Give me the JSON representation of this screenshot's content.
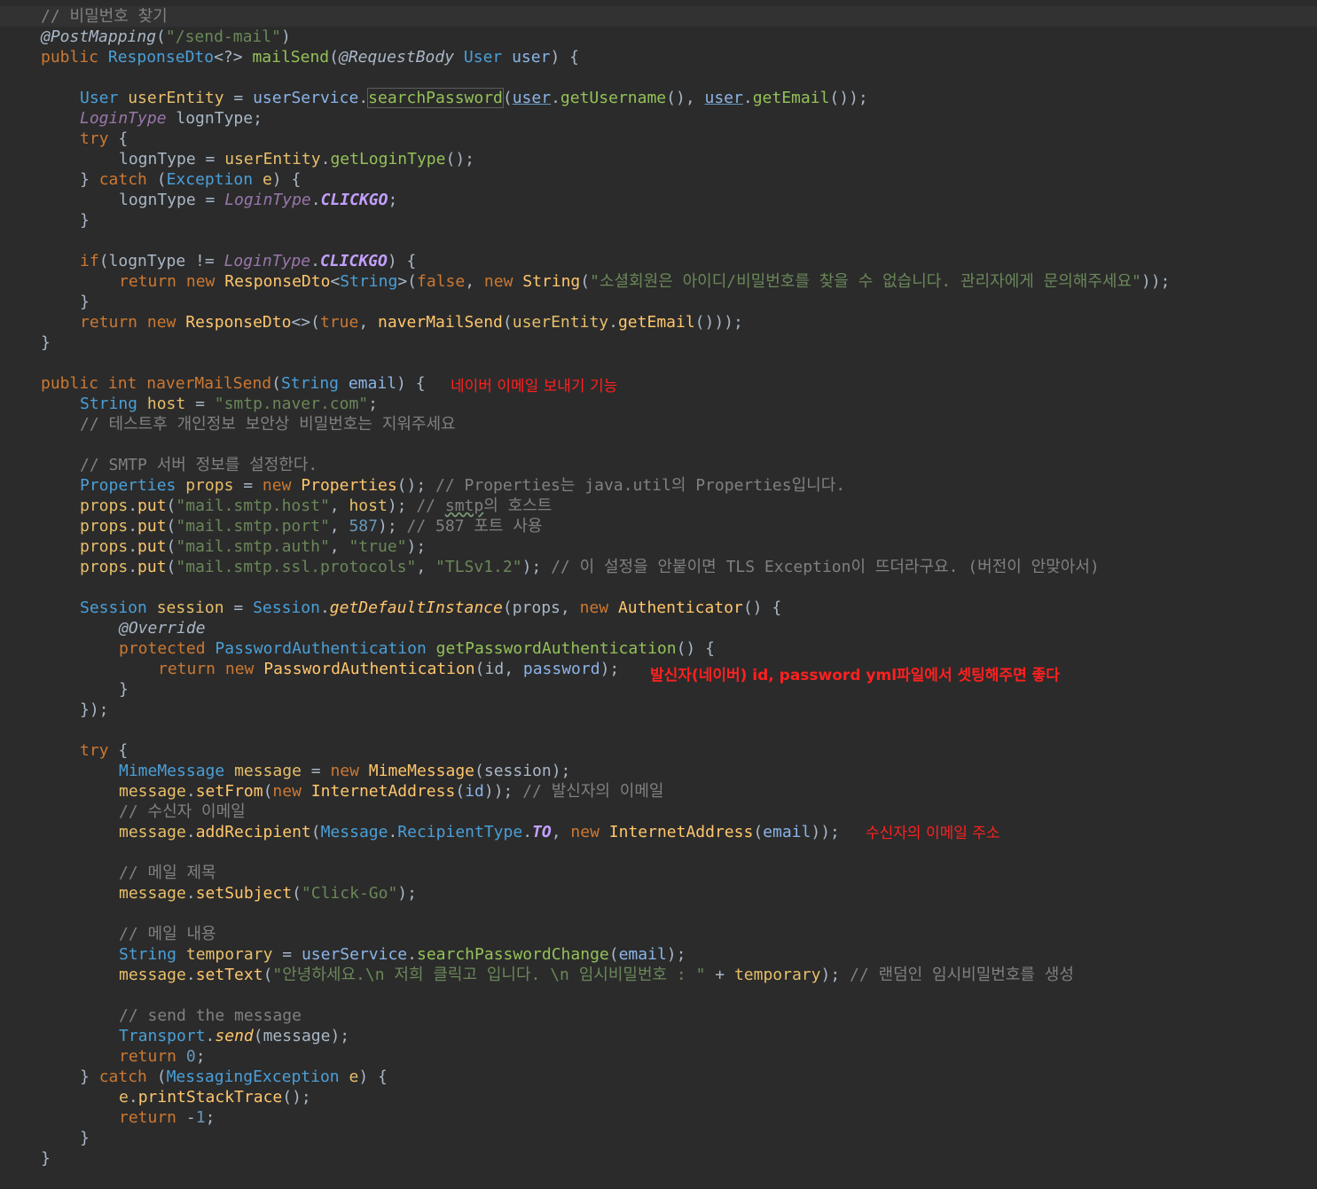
{
  "theme": {
    "background": "#2b2b2b",
    "keyword": "#cc7832",
    "string": "#6a8759",
    "comment": "#808080",
    "annotation_note": "#ff2020"
  },
  "code": {
    "l1": "// 비밀번호 찾기",
    "l2": [
      "@PostMapping",
      "(",
      "\"/send-mail\"",
      ")"
    ],
    "l3": [
      "public",
      " ",
      "ResponseDto",
      "<?> ",
      "mailSend",
      "(",
      "@RequestBody",
      " ",
      "User",
      " ",
      "user",
      ") {"
    ],
    "l5": [
      "User",
      " ",
      "userEntity",
      " = ",
      "userService",
      ".",
      "searchPassword",
      "(",
      "user",
      ".",
      "getUsername",
      "(), ",
      "user",
      ".",
      "getEmail",
      "());"
    ],
    "l6": [
      "LoginType",
      " lognType;"
    ],
    "l7": [
      "try",
      " {"
    ],
    "l8": [
      "lognType = ",
      "userEntity",
      ".",
      "getLoginType",
      "();"
    ],
    "l9": [
      "} ",
      "catch",
      " (",
      "Exception",
      " ",
      "e",
      ") {"
    ],
    "l10": [
      "lognType = ",
      "LoginType",
      ".",
      "CLICKGO",
      ";"
    ],
    "l11": "}",
    "l13": [
      "if",
      "(lognType != ",
      "LoginType",
      ".",
      "CLICKGO",
      ") {"
    ],
    "l14": [
      "return",
      " ",
      "new",
      " ",
      "ResponseDto",
      "<",
      "String",
      ">(",
      "false",
      ", ",
      "new",
      " ",
      "String",
      "(",
      "\"소셜회원은 아이디/비밀번호를 찾을 수 없습니다. 관리자에게 문의해주세요\"",
      "));"
    ],
    "l15": "}",
    "l16": [
      "return",
      " ",
      "new",
      " ",
      "ResponseDto",
      "<>(",
      "true",
      ", ",
      "naverMailSend",
      "(",
      "userEntity",
      ".",
      "getEmail",
      "()));"
    ],
    "l17": "}",
    "l19": [
      "public",
      " ",
      "int",
      " ",
      "naverMailSend",
      "(",
      "String",
      " ",
      "email",
      ") {"
    ],
    "l20": [
      "String",
      " ",
      "host",
      " = ",
      "\"smtp.naver.com\"",
      ";"
    ],
    "l21": "// 테스트후 개인정보 보안상 비밀번호는 지워주세요",
    "l23": "// SMTP 서버 정보를 설정한다.",
    "l24": [
      "Properties",
      " ",
      "props",
      " = ",
      "new",
      " ",
      "Properties",
      "(); ",
      "// Properties는 java.util의 Properties입니다."
    ],
    "l25": [
      "props",
      ".",
      "put",
      "(",
      "\"mail.smtp.host\"",
      ", ",
      "host",
      "); ",
      "// ",
      "smtp",
      "의 호스트"
    ],
    "l26": [
      "props",
      ".",
      "put",
      "(",
      "\"mail.smtp.port\"",
      ", ",
      "587",
      "); ",
      "// 587 포트 사용"
    ],
    "l27": [
      "props",
      ".",
      "put",
      "(",
      "\"mail.smtp.auth\"",
      ", ",
      "\"true\"",
      ");"
    ],
    "l28": [
      "props",
      ".",
      "put",
      "(",
      "\"mail.smtp.ssl.protocols\"",
      ", ",
      "\"TLSv1.2\"",
      "); ",
      "// 이 설정을 안붙이면 TLS Exception이 뜨더라구요. (버전이 안맞아서)"
    ],
    "l30": [
      "Session",
      " ",
      "session",
      " = ",
      "Session",
      ".",
      "getDefaultInstance",
      "(",
      "props",
      ", ",
      "new",
      " ",
      "Authenticator",
      "() {"
    ],
    "l31": "@Override",
    "l32": [
      "protected",
      " ",
      "PasswordAuthentication",
      " ",
      "getPasswordAuthentication",
      "() {"
    ],
    "l33": [
      "return",
      " ",
      "new",
      " ",
      "PasswordAuthentication",
      "(",
      "id",
      ", ",
      "password",
      ");"
    ],
    "l34": "}",
    "l35": "});",
    "l37": [
      "try",
      " {"
    ],
    "l38": [
      "MimeMessage",
      " ",
      "message",
      " = ",
      "new",
      " ",
      "MimeMessage",
      "(",
      "session",
      ");"
    ],
    "l39": [
      "message",
      ".",
      "setFrom",
      "(",
      "new",
      " ",
      "InternetAddress",
      "(",
      "id",
      ")); ",
      "// 발신자의 이메일"
    ],
    "l40": "// 수신자 이메일",
    "l41": [
      "message",
      ".",
      "addRecipient",
      "(",
      "Message",
      ".",
      "RecipientType",
      ".",
      "TO",
      ", ",
      "new",
      " ",
      "InternetAddress",
      "(",
      "email",
      "));"
    ],
    "l43": "// 메일 제목",
    "l44": [
      "message",
      ".",
      "setSubject",
      "(",
      "\"Click-Go\"",
      ");"
    ],
    "l46": "// 메일 내용",
    "l47": [
      "String",
      " ",
      "temporary",
      " = ",
      "userService",
      ".",
      "searchPasswordChange",
      "(",
      "email",
      ");"
    ],
    "l48": [
      "message",
      ".",
      "setText",
      "(",
      "\"안녕하세요.\\n 저희 클릭고 입니다. \\n 임시비밀번호 : \"",
      " + ",
      "temporary",
      "); ",
      "// 랜덤인 임시비밀번호를 생성"
    ],
    "l50": "// send the message",
    "l51": [
      "Transport",
      ".",
      "send",
      "(",
      "message",
      ");"
    ],
    "l52": [
      "return",
      " ",
      "0",
      ";"
    ],
    "l53": [
      "} ",
      "catch",
      " (",
      "MessagingException",
      " ",
      "e",
      ") {"
    ],
    "l54": [
      "e",
      ".",
      "printStackTrace",
      "();"
    ],
    "l55": [
      "return",
      " -",
      "1",
      ";"
    ],
    "l56": "}",
    "l57": "}"
  },
  "annotations": {
    "naver_send": "네이버 이메일 보내기 기능",
    "sender_credentials": "발신자(네이버) id, password yml파일에서 셋팅해주면 좋다",
    "recipient_address": "수신자의 이메일 주소"
  }
}
